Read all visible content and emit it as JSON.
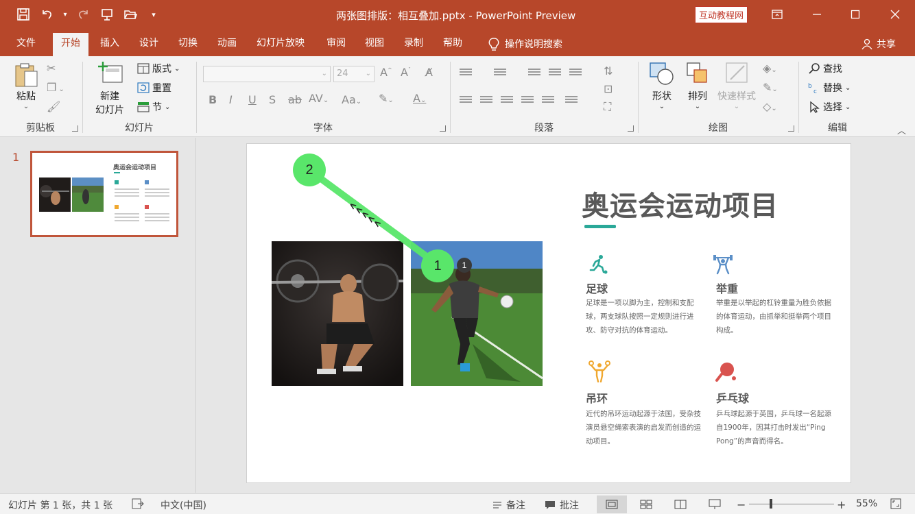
{
  "window": {
    "title": "两张图排版：相互叠加.pptx  -  PowerPoint Preview",
    "brand": "互动教程网"
  },
  "menu": {
    "tabs": [
      "文件",
      "开始",
      "插入",
      "设计",
      "切换",
      "动画",
      "幻灯片放映",
      "审阅",
      "视图",
      "录制",
      "帮助"
    ],
    "active_tab": "开始",
    "search": "操作说明搜索",
    "share": "共享"
  },
  "ribbon": {
    "clipboard": {
      "label": "剪贴板",
      "paste": "粘贴"
    },
    "slides": {
      "label": "幻灯片",
      "new_slide_line1": "新建",
      "new_slide_line2": "幻灯片",
      "layout": "版式",
      "reset": "重置",
      "section": "节"
    },
    "font": {
      "label": "字体",
      "size": "24"
    },
    "paragraph": {
      "label": "段落"
    },
    "drawing": {
      "label": "绘图",
      "shapes": "形状",
      "arrange": "排列",
      "quick_styles": "快速样式"
    },
    "editing": {
      "label": "编辑",
      "find": "查找",
      "replace": "替换",
      "select": "选择"
    }
  },
  "thumbnail": {
    "number": "1",
    "title": "奥运会运动项目"
  },
  "slide": {
    "title": "奥运会运动项目",
    "accent_color": "#2aa898",
    "items": [
      {
        "name": "足球",
        "desc": "足球是一项以脚为主，控制和支配球，两支球队按照一定规则进行进攻、防守对抗的体育运动。",
        "icon": "soccer-icon",
        "color": "#2aa898"
      },
      {
        "name": "举重",
        "desc": "举重是以举起的杠铃重量为胜负依据的体育运动，由抓举和挺举两个项目构成。",
        "icon": "weightlifting-icon",
        "color": "#5b8fc7"
      },
      {
        "name": "吊环",
        "desc": "近代的吊环运动起源于法国，受杂技演员悬空绳索表演的启发而创造的运动项目。",
        "icon": "rings-icon",
        "color": "#f0a830"
      },
      {
        "name": "乒乓球",
        "desc": "乒乓球起源于英国，乒乓球一名起源自1900年，因其打击时发出“Ping Pong”的声音而得名。",
        "icon": "table-tennis-icon",
        "color": "#d9534f"
      }
    ]
  },
  "annotations": {
    "badge1": "1",
    "badge2": "2",
    "small_badge": "1",
    "arrows": "<<<<<"
  },
  "status": {
    "slide_info": "幻灯片 第 1 张，共 1 张",
    "language": "中文(中国)",
    "notes": "备注",
    "comments": "批注",
    "zoom": "55%"
  }
}
